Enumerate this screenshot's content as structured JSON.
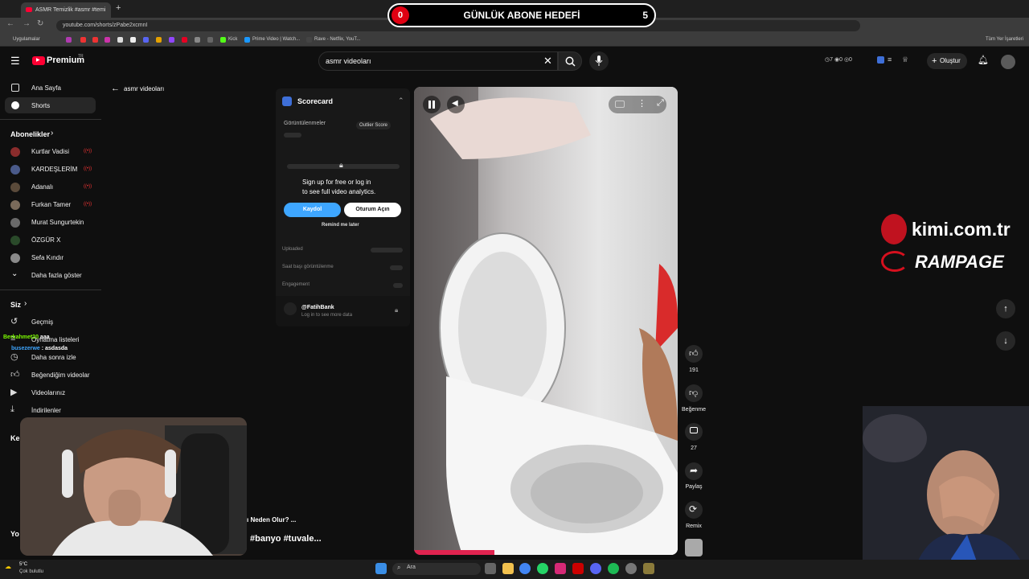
{
  "browser": {
    "tab_title": "ASMR Temizlik #asmr #temi",
    "url": "youtube.com/shorts/zPabe2xcmnI",
    "bookmarks": [
      "Uygulamalar",
      "Kick",
      "Prime Video | Watch...",
      "Rave - Netflix, YouT...",
      "Tüm Yer İşaretleri"
    ]
  },
  "goal": {
    "current": "0",
    "title": "GÜNLÜK ABONE HEDEFİ",
    "target": "5"
  },
  "header": {
    "logo": "Premium",
    "logo_sup": "TR",
    "search_value": "asmr videoları",
    "stats": [
      "7",
      "0",
      "0"
    ],
    "create_label": "Oluştur"
  },
  "sidebar": {
    "main": [
      {
        "label": "Ana Sayfa"
      },
      {
        "label": "Shorts"
      }
    ],
    "subs_header": "Abonelikler",
    "subs": [
      {
        "label": "Kurtlar Vadisi",
        "color": "#8a2c2c"
      },
      {
        "label": "KARDEŞLERİM",
        "color": "#4a5a8a"
      },
      {
        "label": "Adanalı",
        "color": "#5a4a3a"
      },
      {
        "label": "Furkan Tamer",
        "color": "#7a6a5a"
      },
      {
        "label": "Murat Sungurtekin",
        "color": "#6a6a6a"
      },
      {
        "label": "ÖZGÜR X",
        "color": "#2a4a2a"
      },
      {
        "label": "Sefa Kındır",
        "color": "#8a8a8a"
      }
    ],
    "more": "Daha fazla göster",
    "you_header": "Siz",
    "you": [
      {
        "label": "Geçmiş"
      },
      {
        "label": "Oynatma listeleri"
      },
      {
        "label": "Daha sonra izle"
      },
      {
        "label": "Beğendiğim videolar"
      },
      {
        "label": "Videolarınız"
      },
      {
        "label": "İndirilenler"
      }
    ],
    "cut_header": "Ke",
    "cut_header2": "Yo"
  },
  "back_label": "asmr videoları",
  "scorecard": {
    "title": "Scorecard",
    "views_label": "Görüntülenmeler",
    "outlier_label": "Outlier Score",
    "signup_line1": "Sign up for free or log in",
    "signup_line2": "to see full video analytics.",
    "signup_btn": "Kaydol",
    "login_btn": "Oturum Açın",
    "remind": "Remind me later",
    "uploaded": "Uploaded",
    "hourly": "Saat başı görüntülenme",
    "engagement": "Engagement",
    "channel": "@FatihBank",
    "channel_sub": "Log in to see more data"
  },
  "actions": {
    "likes": "191",
    "dislike": "Beğenme",
    "comments": "27",
    "share": "Paylaş",
    "remix": "Remix"
  },
  "branding": {
    "site": "kimi.com.tr",
    "brand": "RAMPAGE"
  },
  "chat": [
    {
      "user": "Berkahmet20",
      "msg": "aaa",
      "color": "#7CFC00"
    },
    {
      "user": "busezerwe",
      "msg": ": asdasda",
      "color": "#3ea6ff"
    }
  ],
  "overlay": {
    "line1": "ı Neden Olur? ...",
    "line2": "#banyo #tuvale..."
  },
  "taskbar": {
    "weather_temp": "5°C",
    "weather_desc": "Çok bulutlu",
    "search": "Ara"
  }
}
